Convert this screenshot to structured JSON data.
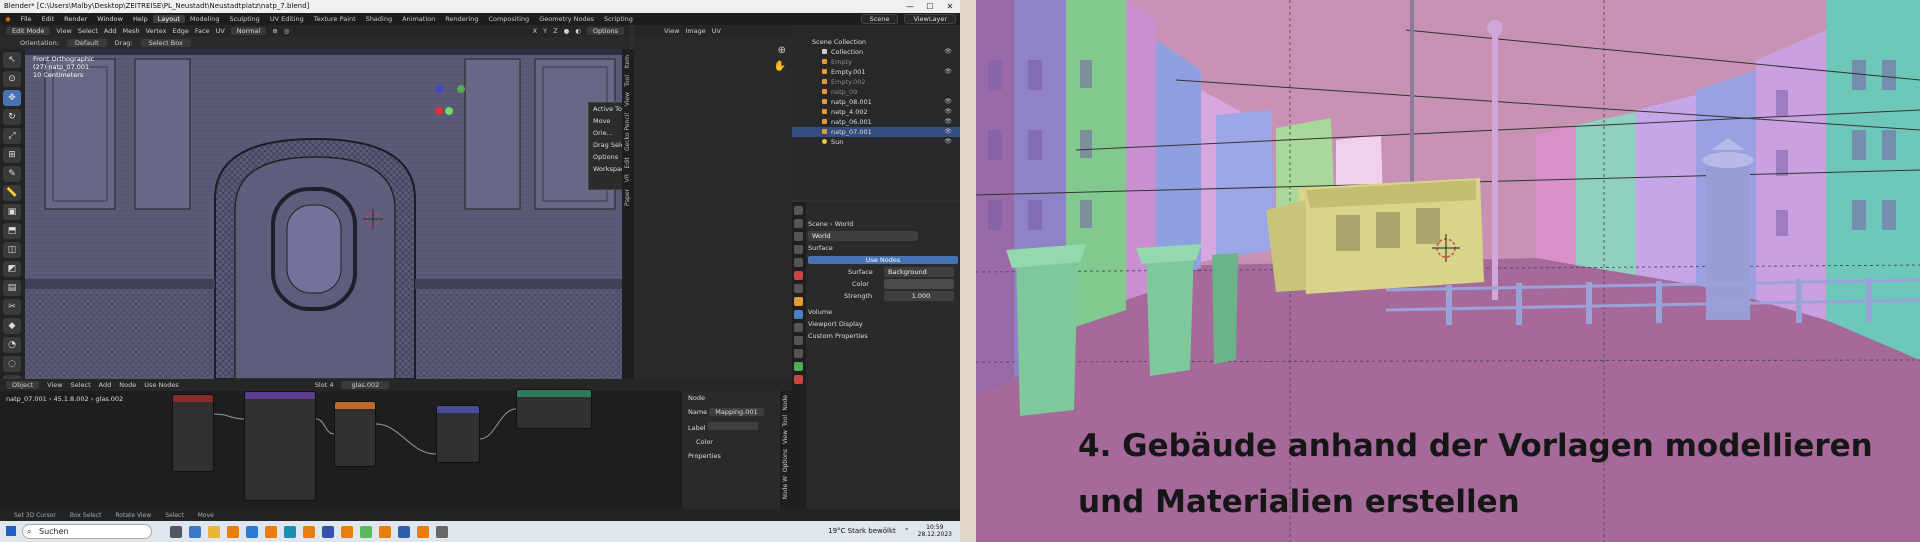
{
  "window": {
    "title": "Blender* [C:\\Users\\Malby\\Desktop\\ZEITREISE\\PL_Neustadt\\Neustadtplatz\\natp_7.blend]",
    "controls": [
      "—",
      "☐",
      "✕"
    ]
  },
  "menubar": {
    "items": [
      "File",
      "Edit",
      "Render",
      "Window",
      "Help"
    ],
    "workspaces": [
      "Layout",
      "Modeling",
      "Sculpting",
      "UV Editing",
      "Texture Paint",
      "Shading",
      "Animation",
      "Rendering",
      "Compositing",
      "Geometry Nodes",
      "Scripting"
    ],
    "active_workspace": "Layout",
    "scene": "Scene",
    "view_layer": "ViewLayer"
  },
  "viewport_header": {
    "mode": "Edit Mode",
    "menus": [
      "View",
      "Select",
      "Add",
      "Mesh",
      "Vertex",
      "Edge",
      "Face",
      "UV"
    ],
    "transform": "Normal",
    "options": "Options",
    "axes": [
      "X",
      "Y",
      "Z"
    ]
  },
  "tool_settings": {
    "orientation_label": "Orientation:",
    "orientation_value": "Default",
    "drag_label": "Drag:",
    "drag_value": "Select Box"
  },
  "viewport_info": {
    "line1": "Front Orthographic",
    "line2": "(27) natp_07.001",
    "line3": "10 Centimeters"
  },
  "n_panel": {
    "section": "Active Tool",
    "move": "Move",
    "orient_label": "Orie...",
    "drag_label": "Drag",
    "drag_value": "Select...",
    "options": "Options",
    "workspace": "Workspace"
  },
  "side_tabs": [
    "Item",
    "Tool",
    "View",
    "Gecko Pencil",
    "Edit",
    "VR",
    "Paper"
  ],
  "image_editor": {
    "menus": [
      "View",
      "Image",
      "UV"
    ]
  },
  "outliner": {
    "header": "Scene Collection",
    "rows": [
      {
        "label": "Collection",
        "selected": false
      },
      {
        "label": "Empty",
        "selected": false
      },
      {
        "label": "Empty.001",
        "selected": false
      },
      {
        "label": "Empty.002",
        "selected": false
      },
      {
        "label": "natp_09",
        "selected": false
      },
      {
        "label": "natp_08.001",
        "selected": false
      },
      {
        "label": "natp_4.002",
        "selected": false
      },
      {
        "label": "natp_06.001",
        "selected": false
      },
      {
        "label": "natp_07.001",
        "selected": true
      },
      {
        "label": "Sun",
        "selected": false
      }
    ]
  },
  "properties": {
    "breadcrumb_scene": "Scene",
    "breadcrumb_world": "World",
    "world_name": "World",
    "surface_section": "Surface",
    "use_nodes": "Use Nodes",
    "surface_label": "Surface",
    "surface_value": "Background",
    "color_label": "Color",
    "strength_label": "Strength",
    "strength_value": "1.000",
    "volume": "Volume",
    "viewport_display": "Viewport Display",
    "custom_properties": "Custom Properties"
  },
  "node_editor": {
    "type": "Object",
    "menus": [
      "View",
      "Select",
      "Add",
      "Node"
    ],
    "use_nodes": "Use Nodes",
    "slot": "Slot 4",
    "material": "glas.002",
    "bc_object": "natp_07.001",
    "bc_mesh": "45.1.8.002",
    "bc_material": "glas.002",
    "sidebar_node": "Node",
    "sidebar_name_label": "Name",
    "sidebar_name_value": "Mapping.001",
    "sidebar_label_label": "Label",
    "sidebar_color": "Color",
    "sidebar_properties": "Properties",
    "sidebar_tabs": [
      "Node",
      "Tool",
      "View",
      "Options",
      "Node W"
    ]
  },
  "statusbar": {
    "items": [
      "Set 3D Cursor",
      "Box Select",
      "Rotate View",
      "Select",
      "Move"
    ]
  },
  "taskbar": {
    "search_placeholder": "Suchen",
    "weather": "19°C  Stark bewölkt",
    "time": "10:59",
    "date": "28.12.2023"
  },
  "slide": {
    "caption_line1": "4. Gebäude anhand der Vorlagen modellieren",
    "caption_line2": "und Materialien erstellen"
  }
}
